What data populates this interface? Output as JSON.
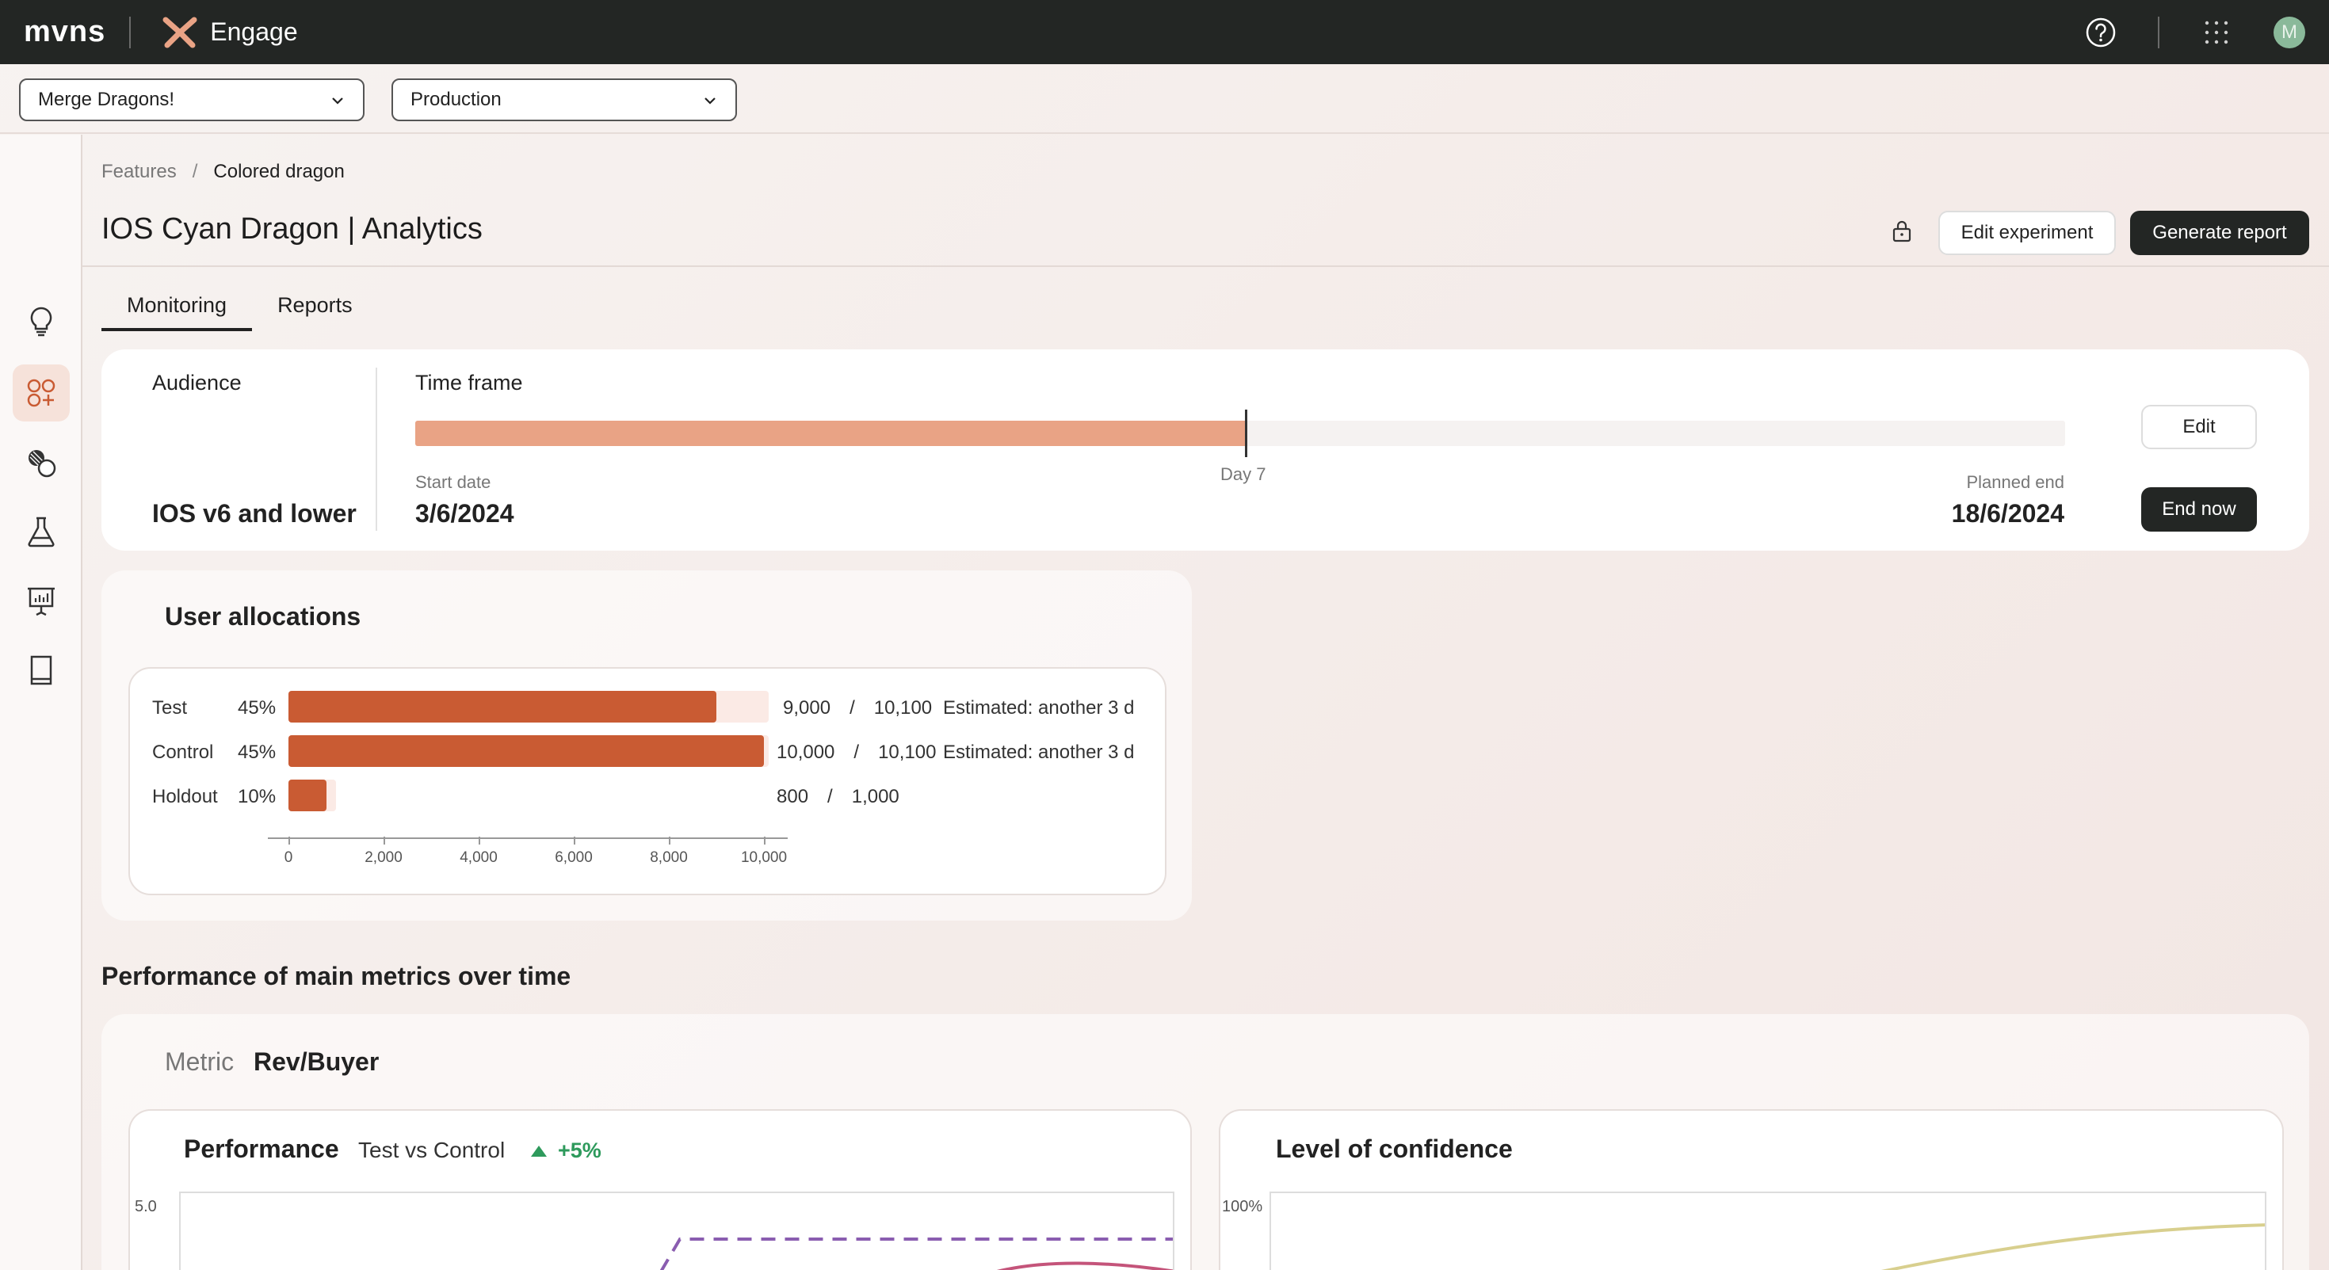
{
  "app": {
    "brand": "mvns",
    "product": "Engage",
    "avatar_initial": "M"
  },
  "selectors": {
    "game": "Merge Dragons!",
    "environment": "Production"
  },
  "breadcrumb": {
    "parent": "Features",
    "separator": "/",
    "current": "Colored dragon"
  },
  "header": {
    "title": "IOS Cyan Dragon | Analytics",
    "edit_experiment": "Edit experiment",
    "generate_report": "Generate report"
  },
  "tabs": [
    {
      "label": "Monitoring",
      "active": true
    },
    {
      "label": "Reports",
      "active": false
    }
  ],
  "summary": {
    "audience_label": "Audience",
    "audience_value": "IOS v6 and lower",
    "timeframe_label": "Time frame",
    "progress_fraction": 0.504,
    "marker_label": "Day 7",
    "start_label": "Start date",
    "start_value": "3/6/2024",
    "end_label": "Planned end",
    "end_value": "18/6/2024",
    "edit_label": "Edit",
    "end_now_label": "End now"
  },
  "allocations": {
    "title": "User allocations",
    "rows": [
      {
        "name": "Test",
        "pct": "45%",
        "current": 9000,
        "target": 10100,
        "current_text": "9,000",
        "sep": "/",
        "target_text": "10,100",
        "estimate": "Estimated: another 3 d"
      },
      {
        "name": "Control",
        "pct": "45%",
        "current": 10000,
        "target": 10100,
        "current_text": "10,000",
        "sep": "/",
        "target_text": "10,100",
        "estimate": "Estimated: another 3 d"
      },
      {
        "name": "Holdout",
        "pct": "10%",
        "current": 800,
        "target": 1000,
        "current_text": "800",
        "sep": "/",
        "target_text": "1,000",
        "estimate": ""
      }
    ],
    "axis_ticks": [
      "0",
      "2,000",
      "4,000",
      "6,000",
      "8,000",
      "10,000"
    ],
    "axis_max": 10000
  },
  "performance": {
    "section_title": "Performance of main metrics over time",
    "metric_label": "Metric",
    "metric_value": "Rev/Buyer",
    "performance_title": "Performance",
    "comparison": "Test vs Control",
    "delta": "+5%",
    "perf_y_top": "5.0",
    "confidence_title": "Level of confidence",
    "conf_y_top": "100%"
  },
  "colors": {
    "accent": "#c95b33",
    "timeline": "#e9a385",
    "positive": "#2e9a5c",
    "dashed_series": "#8a5db0",
    "pink_series": "#c4547a",
    "confidence_series": "#d8cf8e"
  }
}
